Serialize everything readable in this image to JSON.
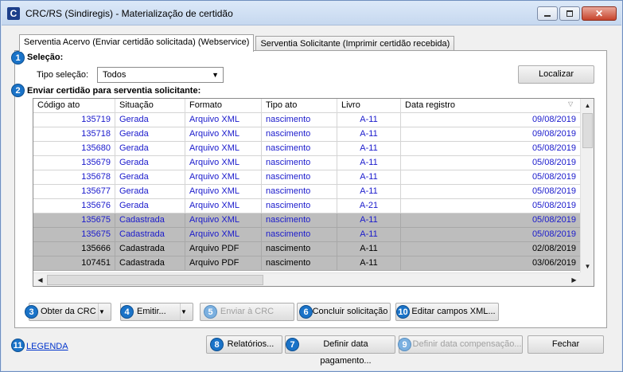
{
  "window": {
    "title": "CRC/RS (Sindiregis) - Materialização de certidão",
    "app_icon": "C"
  },
  "tabs": [
    {
      "label": "Serventia Acervo (Enviar certidão solicitada) (Webservice)"
    },
    {
      "label": "Serventia Solicitante (Imprimir certidão recebida)"
    }
  ],
  "selecao": {
    "badge": "1",
    "label": "Seleção:",
    "tipo_label": "Tipo seleção:",
    "tipo_value": "Todos",
    "localizar": "Localizar"
  },
  "enviar": {
    "badge": "2",
    "label": "Enviar certidão para serventia solicitante:"
  },
  "grid": {
    "columns": [
      "Código ato",
      "Situação",
      "Formato",
      "Tipo ato",
      "Livro",
      "Data registro"
    ],
    "rows": [
      {
        "codigo": "135719",
        "situacao": "Gerada",
        "formato": "Arquivo XML",
        "tipo": "nascimento",
        "livro": "A-11",
        "data": "09/08/2019",
        "style": "blue"
      },
      {
        "codigo": "135718",
        "situacao": "Gerada",
        "formato": "Arquivo XML",
        "tipo": "nascimento",
        "livro": "A-11",
        "data": "09/08/2019",
        "style": "blue"
      },
      {
        "codigo": "135680",
        "situacao": "Gerada",
        "formato": "Arquivo XML",
        "tipo": "nascimento",
        "livro": "A-11",
        "data": "05/08/2019",
        "style": "blue"
      },
      {
        "codigo": "135679",
        "situacao": "Gerada",
        "formato": "Arquivo XML",
        "tipo": "nascimento",
        "livro": "A-11",
        "data": "05/08/2019",
        "style": "blue"
      },
      {
        "codigo": "135678",
        "situacao": "Gerada",
        "formato": "Arquivo XML",
        "tipo": "nascimento",
        "livro": "A-11",
        "data": "05/08/2019",
        "style": "blue"
      },
      {
        "codigo": "135677",
        "situacao": "Gerada",
        "formato": "Arquivo XML",
        "tipo": "nascimento",
        "livro": "A-11",
        "data": "05/08/2019",
        "style": "blue"
      },
      {
        "codigo": "135676",
        "situacao": "Gerada",
        "formato": "Arquivo XML",
        "tipo": "nascimento",
        "livro": "A-21",
        "data": "05/08/2019",
        "style": "blue"
      },
      {
        "codigo": "135675",
        "situacao": "Cadastrada",
        "formato": "Arquivo XML",
        "tipo": "nascimento",
        "livro": "A-11",
        "data": "05/08/2019",
        "style": "gray-blue"
      },
      {
        "codigo": "135675",
        "situacao": "Cadastrada",
        "formato": "Arquivo XML",
        "tipo": "nascimento",
        "livro": "A-11",
        "data": "05/08/2019",
        "style": "gray-blue"
      },
      {
        "codigo": "135666",
        "situacao": "Cadastrada",
        "formato": "Arquivo PDF",
        "tipo": "nascimento",
        "livro": "A-11",
        "data": "02/08/2019",
        "style": "gray"
      },
      {
        "codigo": "107451",
        "situacao": "Cadastrada",
        "formato": "Arquivo PDF",
        "tipo": "nascimento",
        "livro": "A-11",
        "data": "03/06/2019",
        "style": "gray"
      }
    ]
  },
  "actions": {
    "obter": {
      "badge": "3",
      "label": "Obter da CRC"
    },
    "emitir": {
      "badge": "4",
      "label": "Emitir..."
    },
    "enviar": {
      "badge": "5",
      "label": "Enviar à CRC"
    },
    "concluir": {
      "badge": "6",
      "label": "Concluir solicitação"
    },
    "editar": {
      "badge": "10",
      "label": "Editar campos XML..."
    }
  },
  "footer": {
    "legenda": {
      "badge": "11",
      "label": "LEGENDA"
    },
    "relatorios": {
      "badge": "8",
      "label": "Relatórios..."
    },
    "definir_pag": {
      "badge": "7",
      "label": "Definir data pagamento..."
    },
    "definir_comp": {
      "badge": "9",
      "label": "Definir data compensação..."
    },
    "fechar": {
      "label": "Fechar"
    }
  },
  "colors": {
    "badge": "#1a73c8",
    "row_blue_text": "#1a1acc",
    "row_gray_bg": "#bdbdbd"
  }
}
